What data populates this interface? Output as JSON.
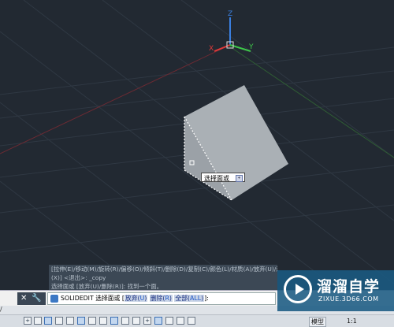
{
  "viewport": {
    "bg_color": "#222932",
    "ucs": {
      "z_label": "Z",
      "y_label": "Y",
      "x_label": "X"
    },
    "tooltip": {
      "text": "选择面或",
      "icon": "plus-icon"
    }
  },
  "command_history": [
    "[拉伸(E)/移动(M)/旋转(R)/偏移(O)/倾斜(T)/删除(D)/复制(C)/颜色(L)/材质(A)/放弃(U)/退出",
    "(X)] <退出>: _copy",
    "选择面或 [放弃(U)/删除(R)]: 找到一个面。"
  ],
  "command_line": {
    "prefix": "SOLIDEDIT 选择面或 [",
    "opt1_label": "放弃(",
    "opt1_key": "U",
    "opt1_end": ")",
    "opt2_label": "删除(",
    "opt2_key": "R",
    "opt2_end": ")",
    "opt3_label": "全部(",
    "opt3_key": "ALL",
    "opt3_end": ")",
    "suffix": "]:"
  },
  "cmd_controls": {
    "close": "✕",
    "settings": "🔧"
  },
  "tab_indicator": "/",
  "status_bar": {
    "model_label": "模型",
    "scale_label": "1:1"
  },
  "watermark": {
    "brand_cn": "溜溜自学",
    "url": "ZIXUE.3D66.COM"
  }
}
